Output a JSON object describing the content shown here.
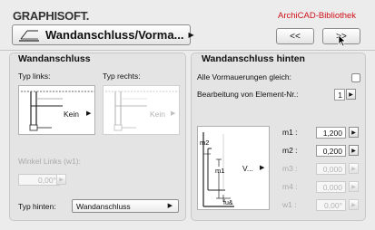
{
  "header": {
    "logo": "GRAPHISOFT.",
    "library": "ArchiCAD-Bibliothek",
    "selector_label": "Wandanschluss/Vorma...",
    "prev_label": "<<",
    "next_label": ">>"
  },
  "left_panel": {
    "title": "Wandanschluss",
    "typ_links_label": "Typ links:",
    "typ_rechts_label": "Typ rechts:",
    "typ_links_value": "Kein",
    "typ_rechts_value": "Kein",
    "winkel_label": "Winkel Links (w1):",
    "winkel_value": "0,00°",
    "typ_hinten_label": "Typ hinten:",
    "typ_hinten_value": "Wandanschluss"
  },
  "right_panel": {
    "title": "Wandanschluss hinten",
    "alle_label": "Alle Vormauerungen gleich:",
    "bearbeitung_label": "Bearbeitung von Element-Nr.:",
    "bearbeitung_value": "1",
    "diagram": {
      "m2": "m2",
      "m1": "m1",
      "v": "V...",
      "fu": "fu&"
    },
    "params": [
      {
        "label": "m1 :",
        "value": "1,200",
        "enabled": true
      },
      {
        "label": "m2 :",
        "value": "0,200",
        "enabled": true
      },
      {
        "label": "m3 :",
        "value": "0,000",
        "enabled": false
      },
      {
        "label": "m4 :",
        "value": "0,000",
        "enabled": false
      },
      {
        "label": "w1 :",
        "value": "0,00°",
        "enabled": false
      }
    ]
  }
}
